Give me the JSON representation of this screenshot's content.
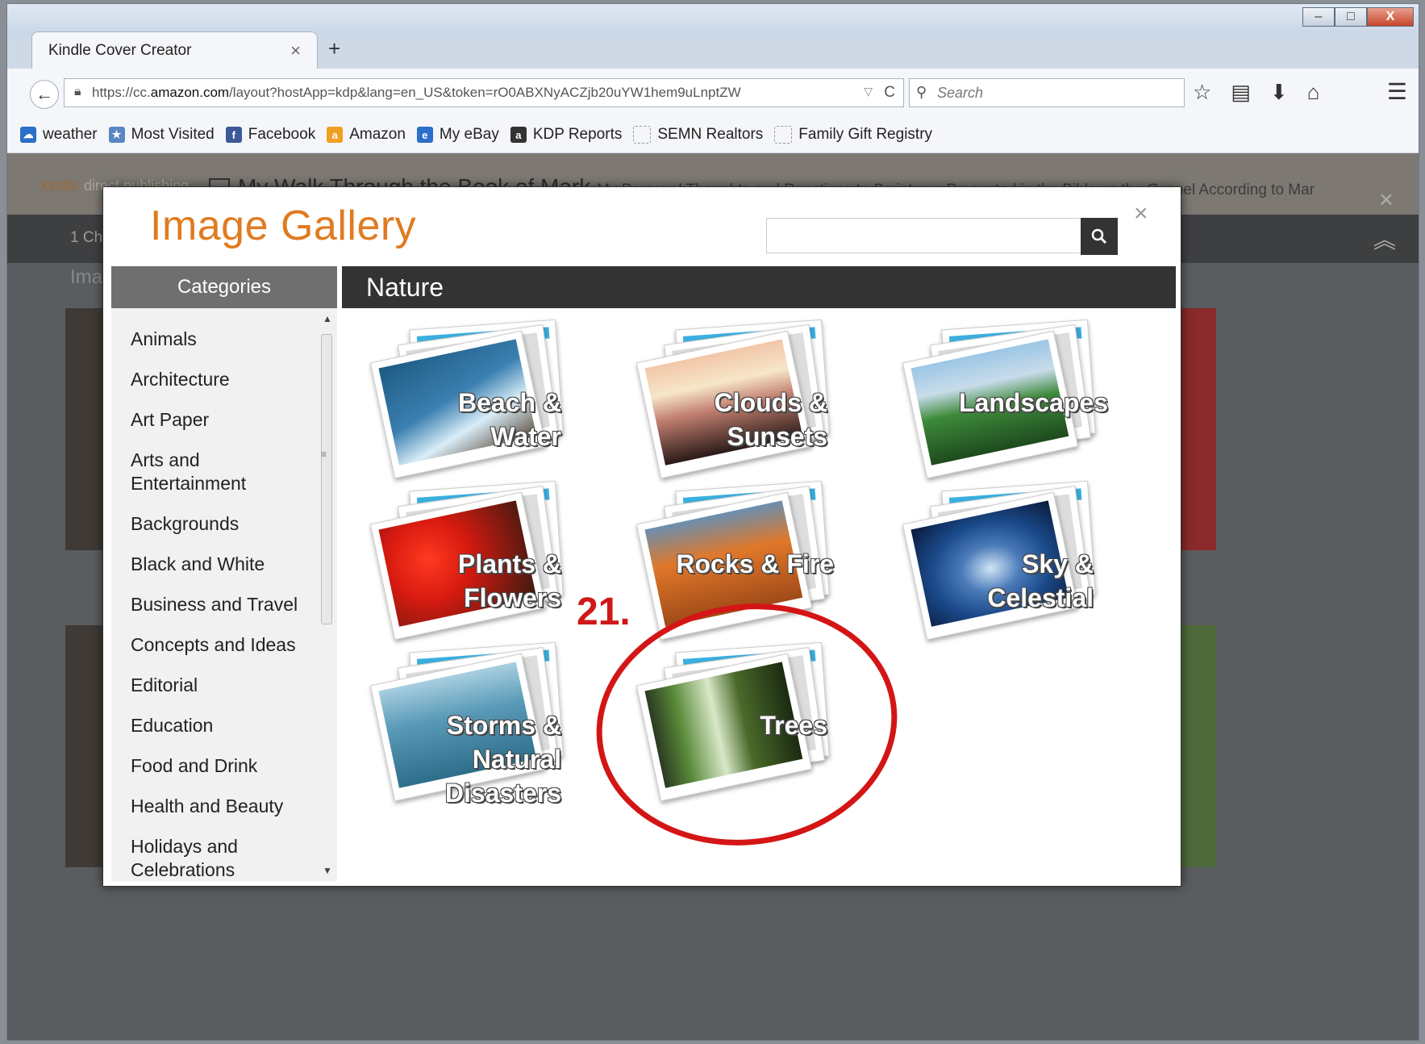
{
  "browser": {
    "tab_title": "Kindle Cover Creator",
    "tab_close": "×",
    "new_tab": "+",
    "url_prefix": "https://cc.",
    "url_domain": "amazon.com",
    "url_rest": "/layout?hostApp=kdp&lang=en_US&token=rO0ABXNyACZjb20uYW1hem9uLnptZW",
    "search_placeholder": "Search",
    "window_buttons": {
      "minimize": "–",
      "maximize": "□",
      "close": "X"
    }
  },
  "bookmarks": [
    {
      "label": "weather",
      "icon": "weather-icon",
      "color": "#2a6fc9"
    },
    {
      "label": "Most Visited",
      "icon": "most-visited-icon",
      "color": "#5b86c4"
    },
    {
      "label": "Facebook",
      "icon": "facebook-icon",
      "color": "#3b5998"
    },
    {
      "label": "Amazon",
      "icon": "amazon-icon",
      "color": "#f0a020"
    },
    {
      "label": "My eBay",
      "icon": "ebay-icon",
      "color": "#2a6fc9"
    },
    {
      "label": "KDP Reports",
      "icon": "kdp-icon",
      "color": "#333333"
    },
    {
      "label": "SEMN Realtors",
      "icon": "folder-icon",
      "color": "#cccccc"
    },
    {
      "label": "Family Gift Registry",
      "icon": "folder-icon",
      "color": "#cccccc"
    }
  ],
  "page": {
    "logo_kindle": "kindle",
    "logo_dp": "direct publishing",
    "book_title": "My Walk Through the Book of Mark",
    "book_subtitle": "My Personal Thoughts and Reactions to Scriptures Presented in the Bible as the Gospel According to Mar",
    "bar_label": "1 Ch",
    "images_label": "Ima"
  },
  "modal": {
    "title": "Image Gallery",
    "close": "×",
    "categories_header": "Categories",
    "section_header": "Nature",
    "categories": [
      "Animals",
      "Architecture",
      "Art Paper",
      "Arts and Entertainment",
      "Backgrounds",
      "Black and White",
      "Business and Travel",
      "Concepts and Ideas",
      "Editorial",
      "Education",
      "Food and Drink",
      "Health and Beauty",
      "Holidays and Celebrations"
    ],
    "tiles": [
      {
        "label": "Beach & Water",
        "colors": [
          "#3a7fb0",
          "#d9eef8"
        ]
      },
      {
        "label": "Clouds & Sunsets",
        "colors": [
          "#f2c6a8",
          "#2a1a18"
        ]
      },
      {
        "label": "Landscapes",
        "colors": [
          "#3d8a3a",
          "#9cc6e6"
        ]
      },
      {
        "label": "Plants & Flowers",
        "colors": [
          "#d81a10",
          "#3a1a10"
        ]
      },
      {
        "label": "Rocks & Fire",
        "colors": [
          "#e0782a",
          "#6a8fb0"
        ]
      },
      {
        "label": "Sky & Celestial",
        "colors": [
          "#1a4a8a",
          "#cfe6f6"
        ]
      },
      {
        "label": "Storms & Natural Disasters",
        "colors": [
          "#2d6e8a",
          "#a8cfe0"
        ]
      },
      {
        "label": "Trees",
        "colors": [
          "#5a8a3a",
          "#d8e8c8"
        ]
      }
    ]
  },
  "annotation": {
    "step": "21."
  },
  "colors": {
    "accent": "#e07b20",
    "annotation": "#d41515"
  }
}
